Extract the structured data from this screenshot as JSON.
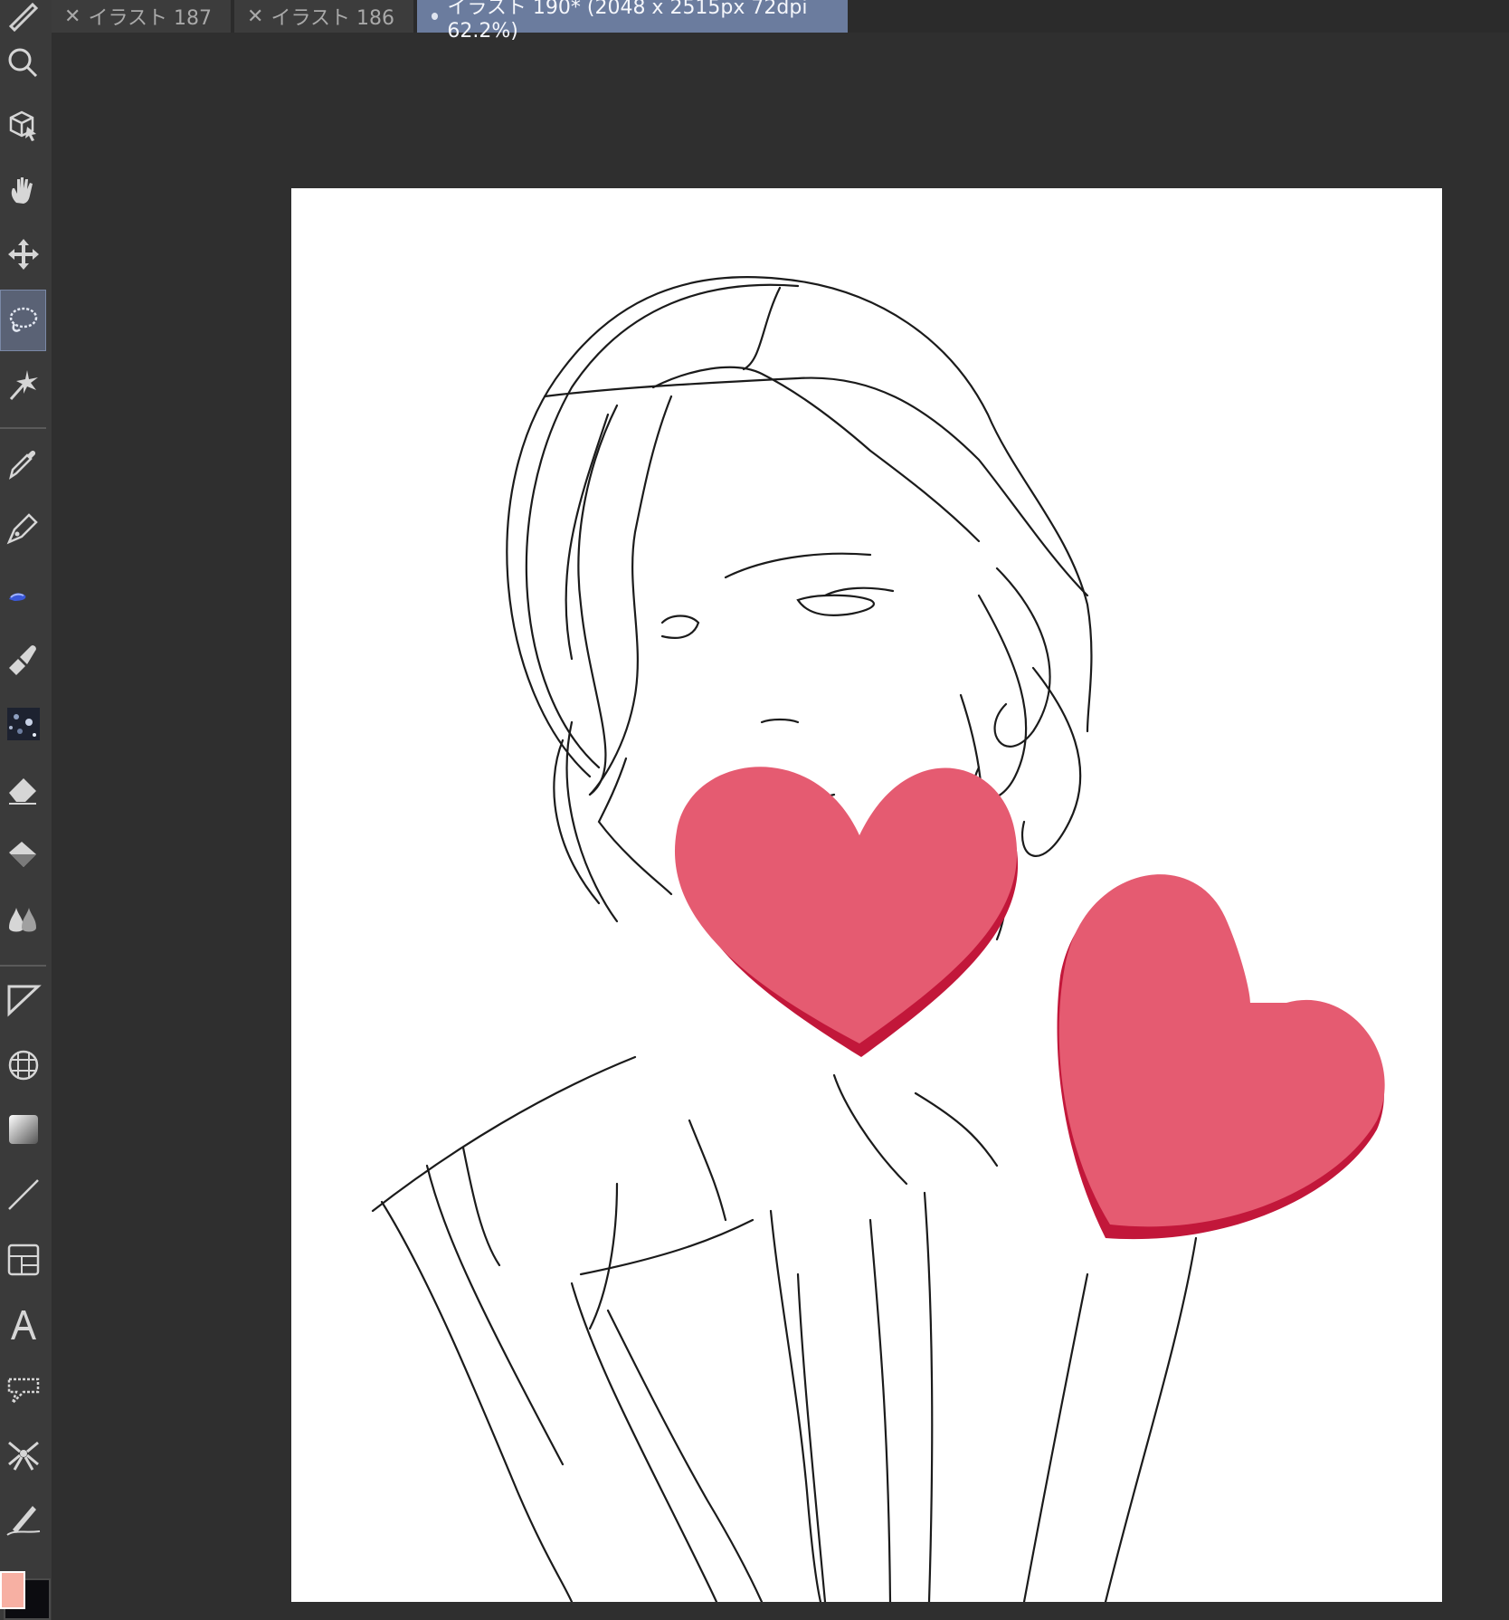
{
  "tabs": [
    {
      "label": "イラスト 187",
      "active": false
    },
    {
      "label": "イラスト 186",
      "active": false
    },
    {
      "label": "イラスト 190* (2048 x 2515px 72dpi 62.2%)",
      "active": true
    }
  ],
  "toolbar": {
    "tools": [
      {
        "name": "zoom-icon",
        "active": false
      },
      {
        "name": "3d-operation-icon",
        "active": false
      },
      {
        "name": "hand-icon",
        "active": false
      },
      {
        "name": "move-layer-icon",
        "active": false
      },
      {
        "name": "lasso-selection-icon",
        "active": true
      },
      {
        "name": "auto-select-icon",
        "active": false
      },
      {
        "name": "eyedropper-icon",
        "active": false
      },
      {
        "name": "pen-icon",
        "active": false
      },
      {
        "name": "pencil-icon",
        "active": false
      },
      {
        "name": "brush-icon",
        "active": false
      },
      {
        "name": "decoration-icon",
        "active": false
      },
      {
        "name": "eraser-icon",
        "active": false
      },
      {
        "name": "fill-icon",
        "active": false
      },
      {
        "name": "blend-icon",
        "active": false
      },
      {
        "name": "figure-icon",
        "active": false
      },
      {
        "name": "ruler-icon",
        "active": false
      },
      {
        "name": "gradient-icon",
        "active": false
      },
      {
        "name": "line-icon",
        "active": false
      },
      {
        "name": "frame-border-icon",
        "active": false
      },
      {
        "name": "text-icon",
        "active": false
      },
      {
        "name": "balloon-icon",
        "active": false
      },
      {
        "name": "effect-line-icon",
        "active": false
      },
      {
        "name": "correct-line-icon",
        "active": false
      }
    ]
  },
  "colors": {
    "main_color": "#f7b0a3",
    "sub_color": "#0c0c10",
    "heart_fill": "#e55b71",
    "heart_shadow": "#c2173a",
    "active_tab": "#6b7c9e"
  }
}
